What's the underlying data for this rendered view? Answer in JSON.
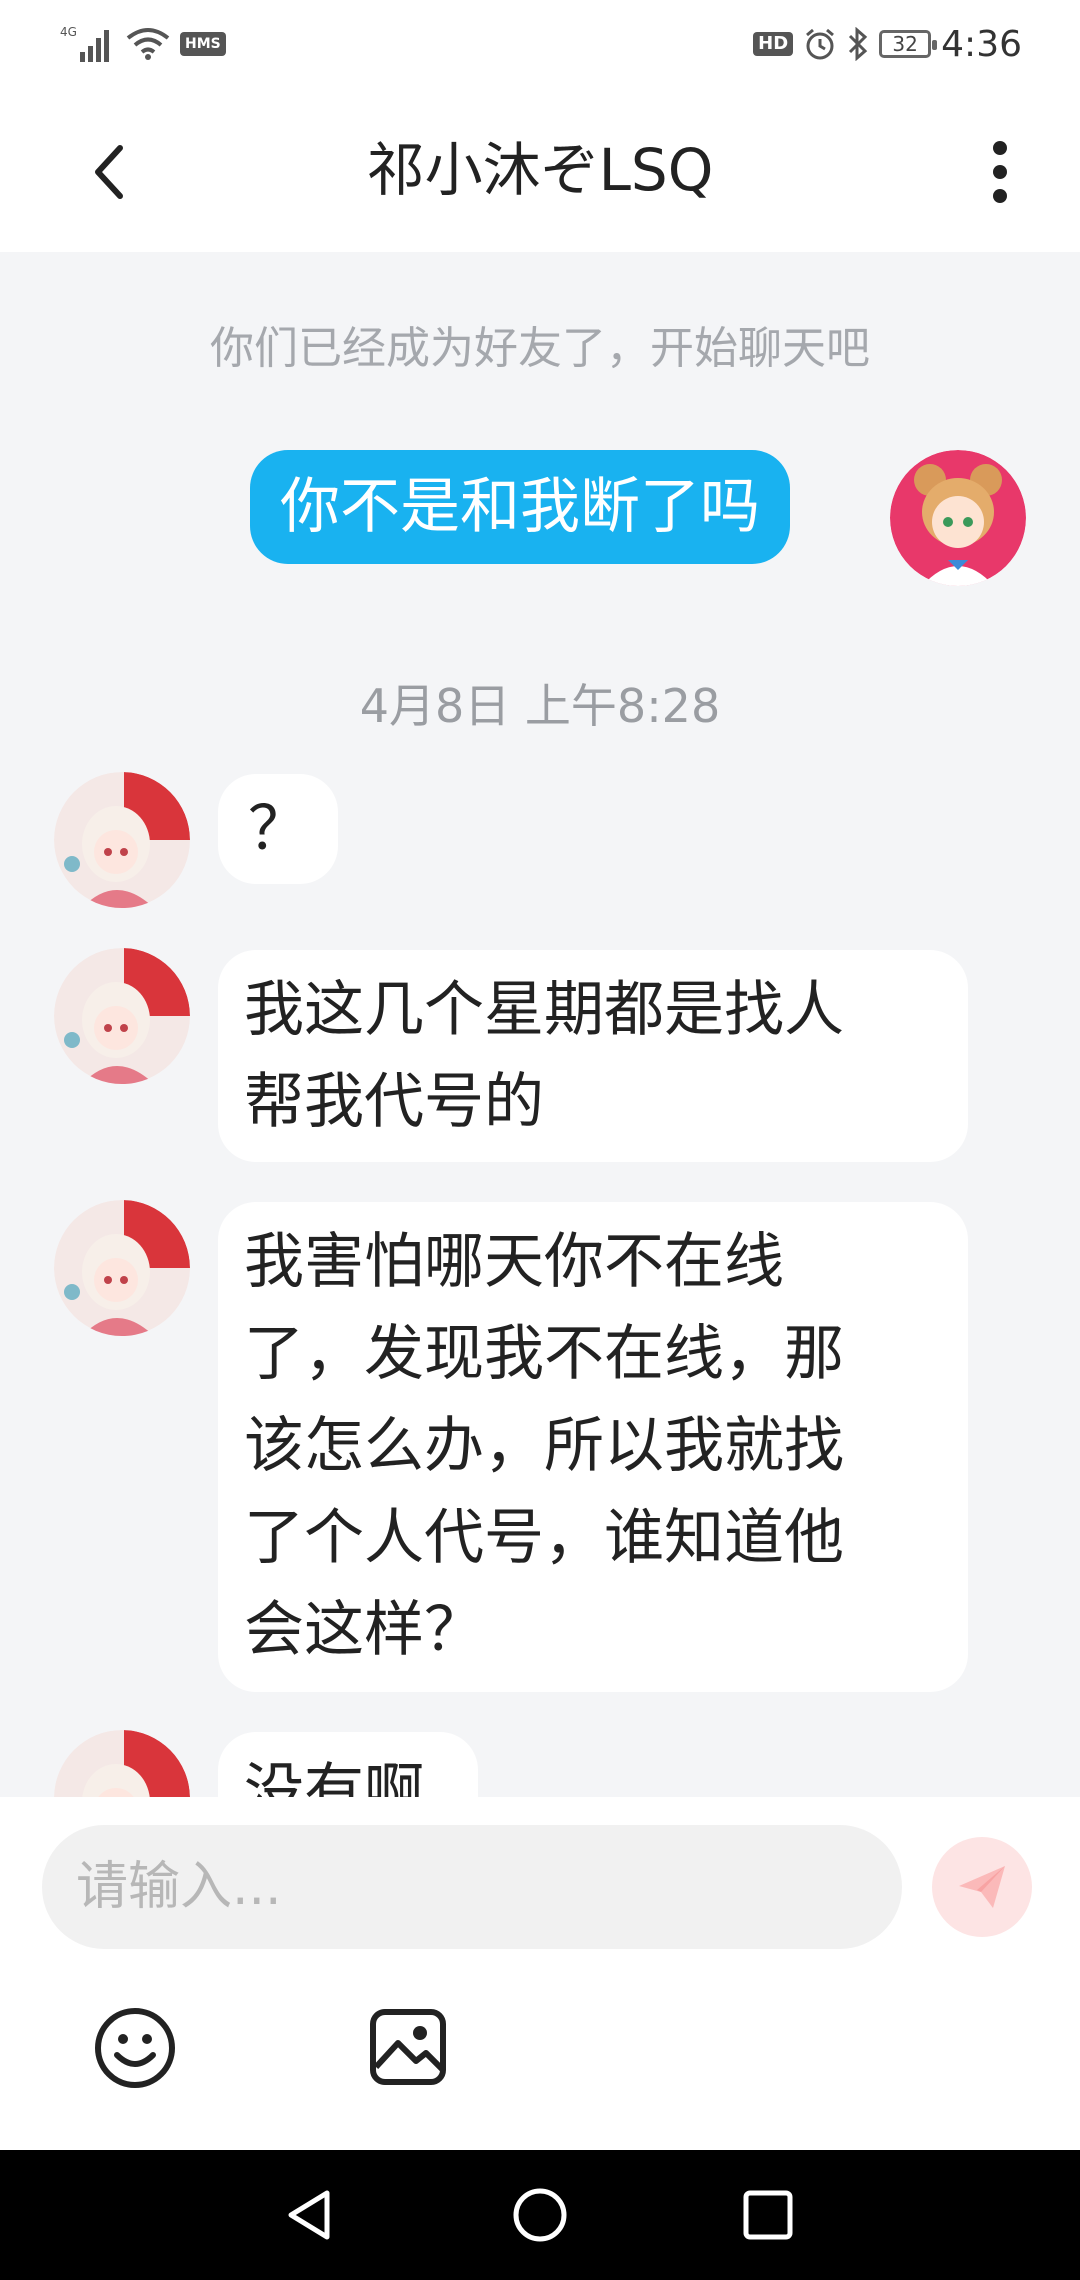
{
  "status_bar": {
    "network": "4G",
    "hms_badge": "HMS",
    "hd_badge": "HD",
    "battery": "32",
    "time": "4:36",
    "icons": [
      "signal-icon",
      "wifi-icon",
      "alarm-icon",
      "bluetooth-icon"
    ]
  },
  "header": {
    "title": "祁小沐ぞLSQ",
    "back_icon": "chevron-left-icon",
    "more_icon": "more-vertical-icon"
  },
  "chat": {
    "system_note": "你们已经成为好友了，开始聊天吧",
    "timestamp": "4月8日 上午8:28",
    "messages": [
      {
        "direction": "out",
        "text": "你不是和我断了吗"
      },
      {
        "direction": "in",
        "text": "？"
      },
      {
        "direction": "in",
        "lines": [
          "我这几个星期都是找人",
          "帮我代号的"
        ]
      },
      {
        "direction": "in",
        "lines": [
          "我害怕哪天你不在线",
          "了，发现我不在线，那",
          "该怎么办，所以我就找",
          "了个人代号，谁知道他",
          "会这样？"
        ]
      },
      {
        "direction": "in",
        "text": "没有啊"
      }
    ]
  },
  "input_bar": {
    "placeholder": "请输入...",
    "send_icon": "send-icon",
    "emoji_icon": "emoji-icon",
    "image_icon": "image-icon"
  },
  "nav_bar": {
    "icons": [
      "nav-back-icon",
      "nav-home-icon",
      "nav-recents-icon"
    ]
  },
  "colors": {
    "outgoing_bubble": "#19b2f0",
    "chat_background": "#f4f5f7",
    "send_button": "#fde4e4"
  }
}
